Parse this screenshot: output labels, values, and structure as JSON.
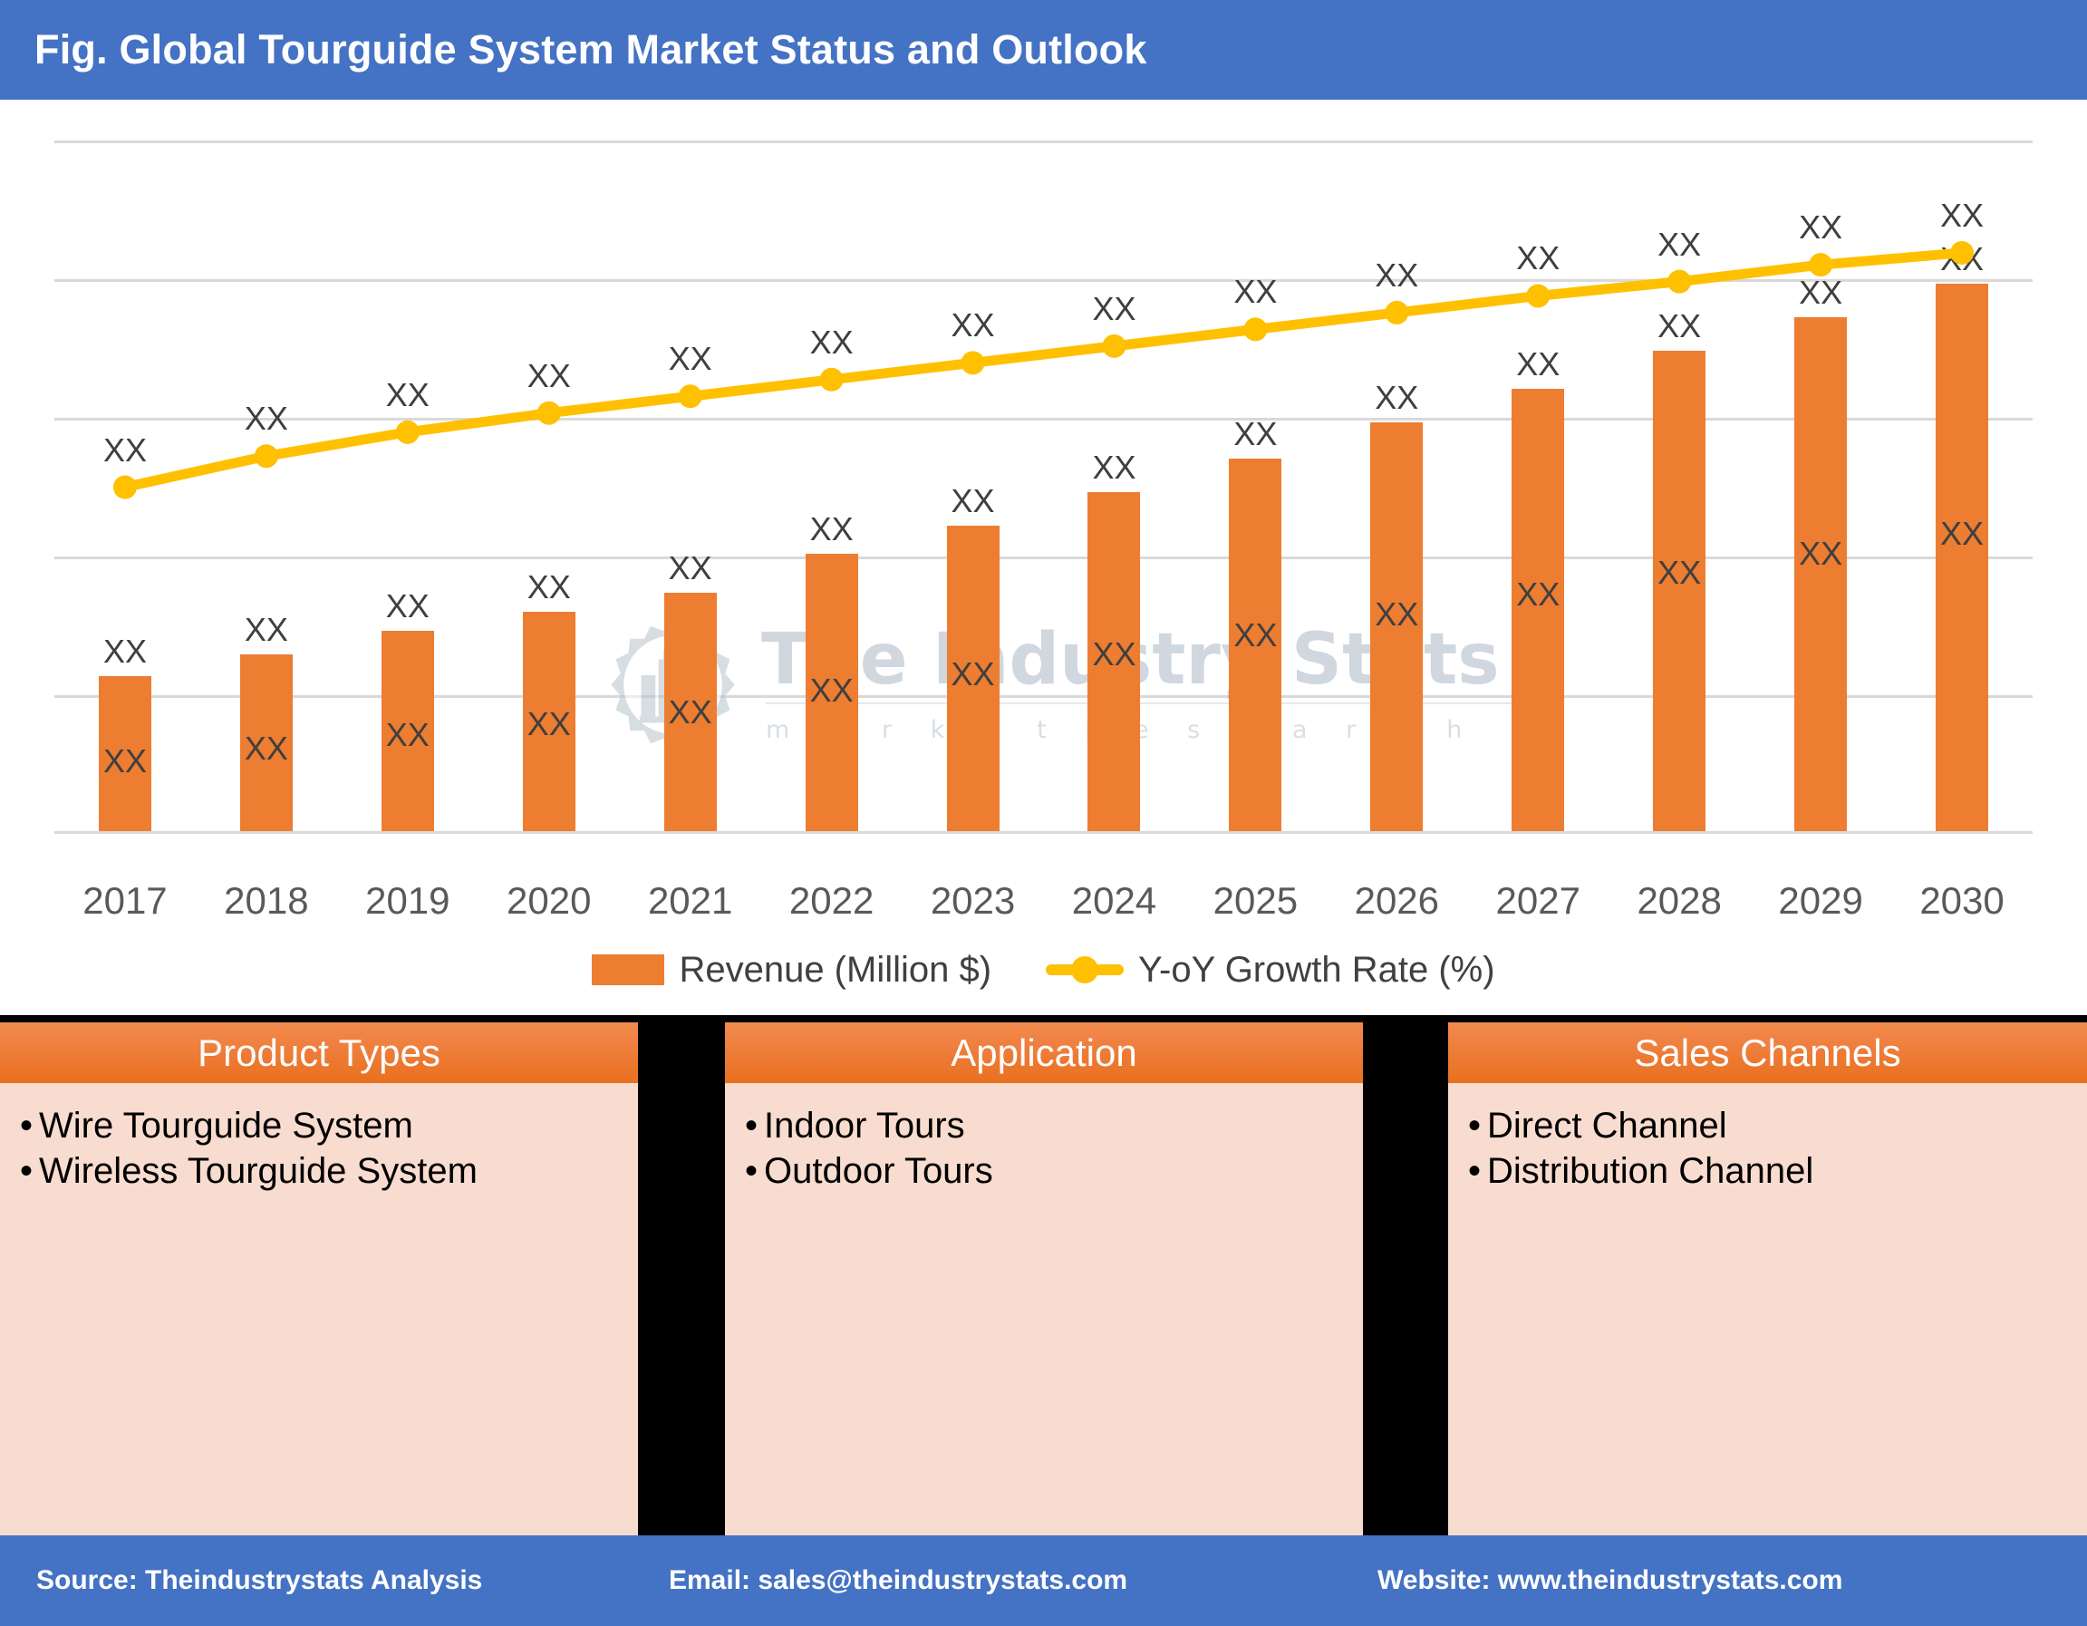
{
  "header": {
    "title": "Fig. Global Tourguide System Market Status and Outlook",
    "bg_color": "#4472c4"
  },
  "watermark": {
    "text": "The Industry Stats",
    "subtext": "m a r k e t    r e s e a r c h",
    "logo_icon": "gear-factory-wrench-logo-icon"
  },
  "chart_data": {
    "type": "bar",
    "title": "Fig. Global Tourguide System Market Status and Outlook",
    "xlabel": "",
    "ylabel": "",
    "grid": true,
    "legend_position": "bottom",
    "categories": [
      "2017",
      "2018",
      "2019",
      "2020",
      "2021",
      "2022",
      "2023",
      "2024",
      "2025",
      "2026",
      "2027",
      "2028",
      "2029",
      "2030"
    ],
    "series": [
      {
        "name": "Revenue (Million $)",
        "type": "bar",
        "color": "#ed7d31",
        "values": [
          66,
          75,
          85,
          93,
          101,
          117,
          129,
          143,
          157,
          172,
          186,
          202,
          216,
          230
        ],
        "value_labels": [
          "XX",
          "XX",
          "XX",
          "XX",
          "XX",
          "XX",
          "XX",
          "XX",
          "XX",
          "XX",
          "XX",
          "XX",
          "XX",
          "XX"
        ],
        "top_labels": [
          "XX",
          "XX",
          "XX",
          "XX",
          "XX",
          "XX",
          "XX",
          "XX",
          "XX",
          "XX",
          "XX",
          "XX",
          "XX",
          "XX"
        ]
      },
      {
        "name": "Y-oY Growth Rate (%)",
        "type": "line",
        "color": "#ffc000",
        "values": [
          145,
          158,
          168,
          176,
          183,
          190,
          197,
          204,
          211,
          218,
          225,
          231,
          238,
          243
        ],
        "point_labels": [
          "XX",
          "XX",
          "XX",
          "XX",
          "XX",
          "XX",
          "XX",
          "XX",
          "XX",
          "XX",
          "XX",
          "XX",
          "XX",
          "XX"
        ]
      }
    ],
    "ylim": [
      0,
      290
    ],
    "gridline_values": [
      290,
      232,
      174,
      116,
      58,
      0
    ]
  },
  "legend": {
    "items": [
      {
        "label": "Revenue (Million $)",
        "marker": "bar-swatch",
        "color": "#ed7d31"
      },
      {
        "label": "Y-oY Growth Rate (%)",
        "marker": "line-marker",
        "color": "#ffc000"
      }
    ]
  },
  "panels": [
    {
      "title": "Product Types",
      "items": [
        "Wire Tourguide System",
        "Wireless Tourguide System"
      ]
    },
    {
      "title": "Application",
      "items": [
        "Indoor Tours",
        "Outdoor Tours"
      ]
    },
    {
      "title": "Sales Channels",
      "items": [
        "Direct Channel",
        "Distribution Channel"
      ]
    }
  ],
  "footer": {
    "source": "Source: Theindustrystats Analysis",
    "email": "Email: sales@theindustrystats.com",
    "website": "Website: www.theindustrystats.com",
    "bg_color": "#4472c4"
  }
}
